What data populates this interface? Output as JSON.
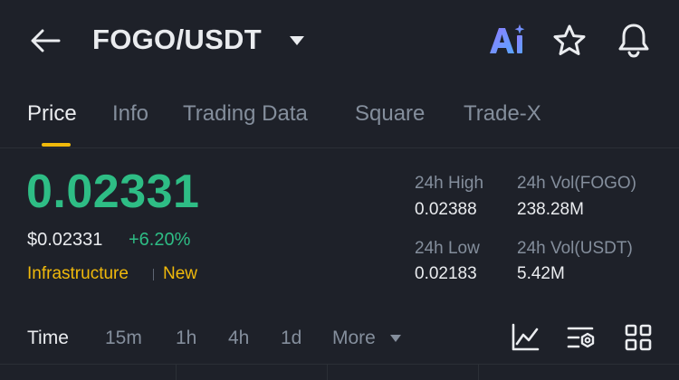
{
  "header": {
    "pair": "FOGO/USDT",
    "icons": {
      "back": "arrow-left-icon",
      "pair_dropdown": "caret-down-icon",
      "ai": "ai-icon",
      "favorite": "star-icon",
      "alerts": "bell-icon"
    }
  },
  "tabs": [
    {
      "label": "Price",
      "active": true
    },
    {
      "label": "Info",
      "active": false
    },
    {
      "label": "Trading Data",
      "active": false
    },
    {
      "label": "Square",
      "active": false
    },
    {
      "label": "Trade-X",
      "active": false
    }
  ],
  "price": {
    "last": "0.02331",
    "usd": "$0.02331",
    "change": "+6.20%"
  },
  "tags": [
    "Infrastructure",
    "New"
  ],
  "stats": {
    "high_label": "24h High",
    "high_value": "0.02388",
    "vol_base_label": "24h Vol(FOGO)",
    "vol_base_value": "238.28M",
    "low_label": "24h Low",
    "low_value": "0.02183",
    "vol_quote_label": "24h Vol(USDT)",
    "vol_quote_value": "5.42M"
  },
  "intervals": {
    "items": [
      "Time",
      "15m",
      "1h",
      "4h",
      "1d",
      "More"
    ],
    "active": "Time"
  },
  "toolbar_icons": [
    "indicator-chart-icon",
    "chart-settings-icon",
    "grid-layout-icon"
  ],
  "colors": {
    "background": "#1e2129",
    "up": "#2ebd85",
    "accent": "#f0b90b",
    "text_primary": "#eaecef",
    "text_secondary": "#848e9c"
  }
}
